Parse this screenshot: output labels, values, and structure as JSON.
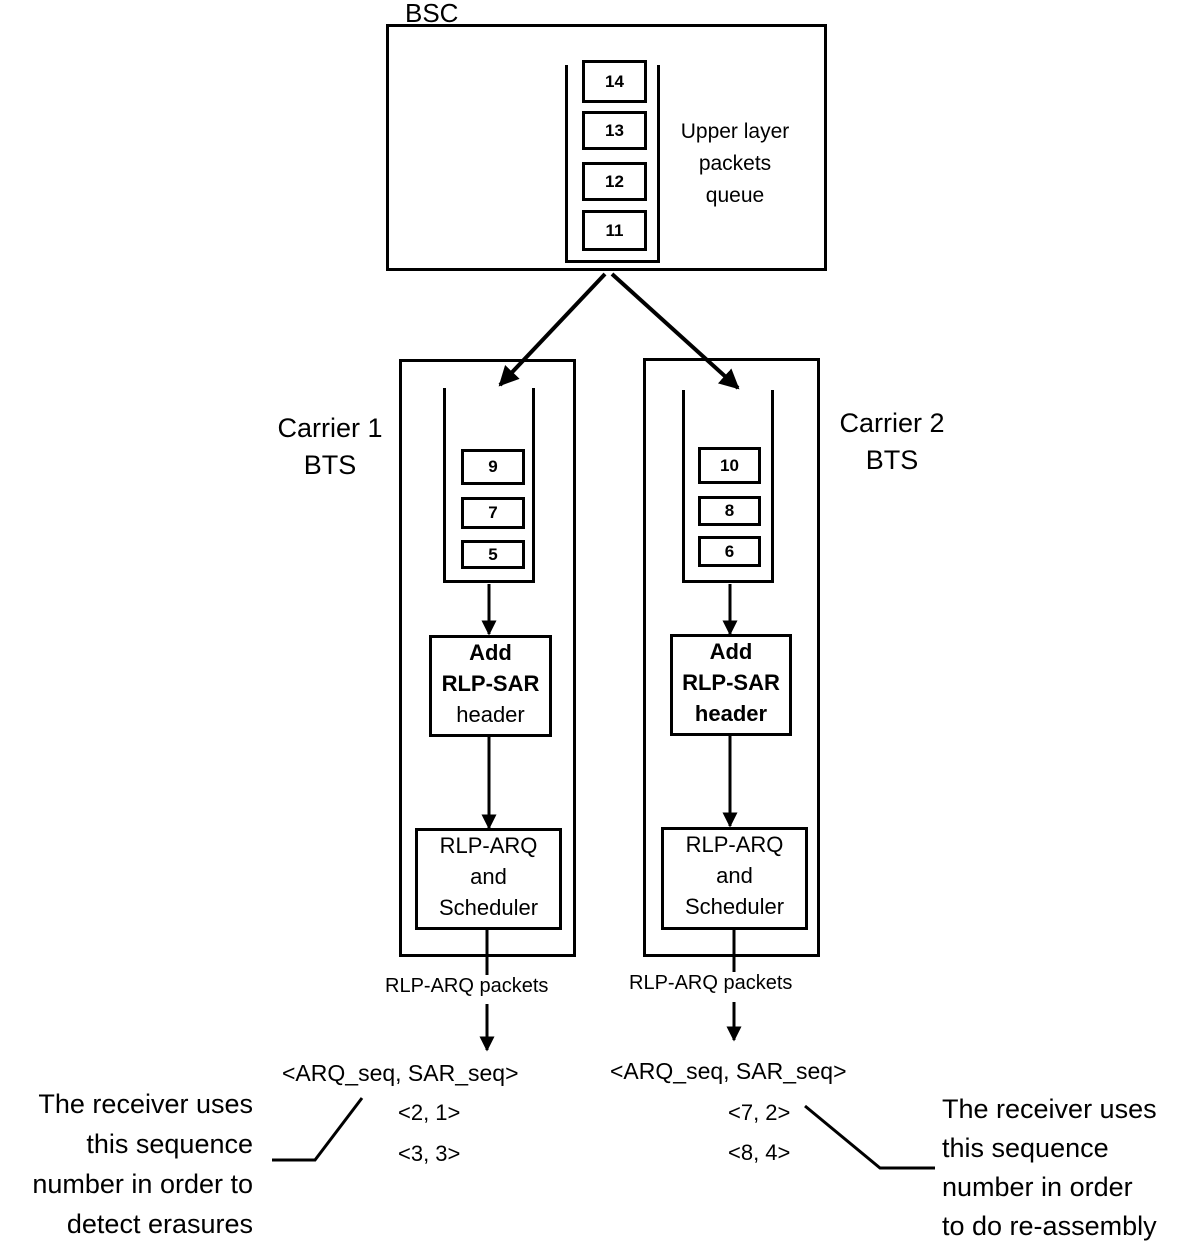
{
  "bsc": {
    "title": "BSC",
    "queue_label": [
      "Upper layer",
      "packets",
      "queue"
    ],
    "packets": [
      "14",
      "13",
      "12",
      "11"
    ]
  },
  "carriers": [
    {
      "title": [
        "Carrier 1",
        "BTS"
      ],
      "packets": [
        "9",
        "7",
        "5"
      ],
      "sar_box": [
        "Add",
        "RLP-SAR",
        "header"
      ],
      "arq_box": [
        "RLP-ARQ",
        "and",
        "Scheduler"
      ],
      "output_label": "RLP-ARQ packets",
      "seq_header": "<ARQ_seq, SAR_seq>",
      "seq_rows": [
        "<2, 1>",
        "<3, 3>"
      ]
    },
    {
      "title": [
        "Carrier 2",
        "BTS"
      ],
      "packets": [
        "10",
        "8",
        "6"
      ],
      "sar_box": [
        "Add",
        "RLP-SAR",
        "header"
      ],
      "arq_box": [
        "RLP-ARQ",
        "and",
        "Scheduler"
      ],
      "output_label": "RLP-ARQ packets",
      "seq_header": "<ARQ_seq, SAR_seq>",
      "seq_rows": [
        "<7, 2>",
        "<8, 4>"
      ]
    }
  ],
  "annotations": {
    "left": [
      "The receiver uses",
      "this sequence",
      "number in order to",
      "detect erasures"
    ],
    "right": [
      "The receiver uses",
      "this sequence",
      "number in order",
      "to do re-assembly"
    ]
  }
}
